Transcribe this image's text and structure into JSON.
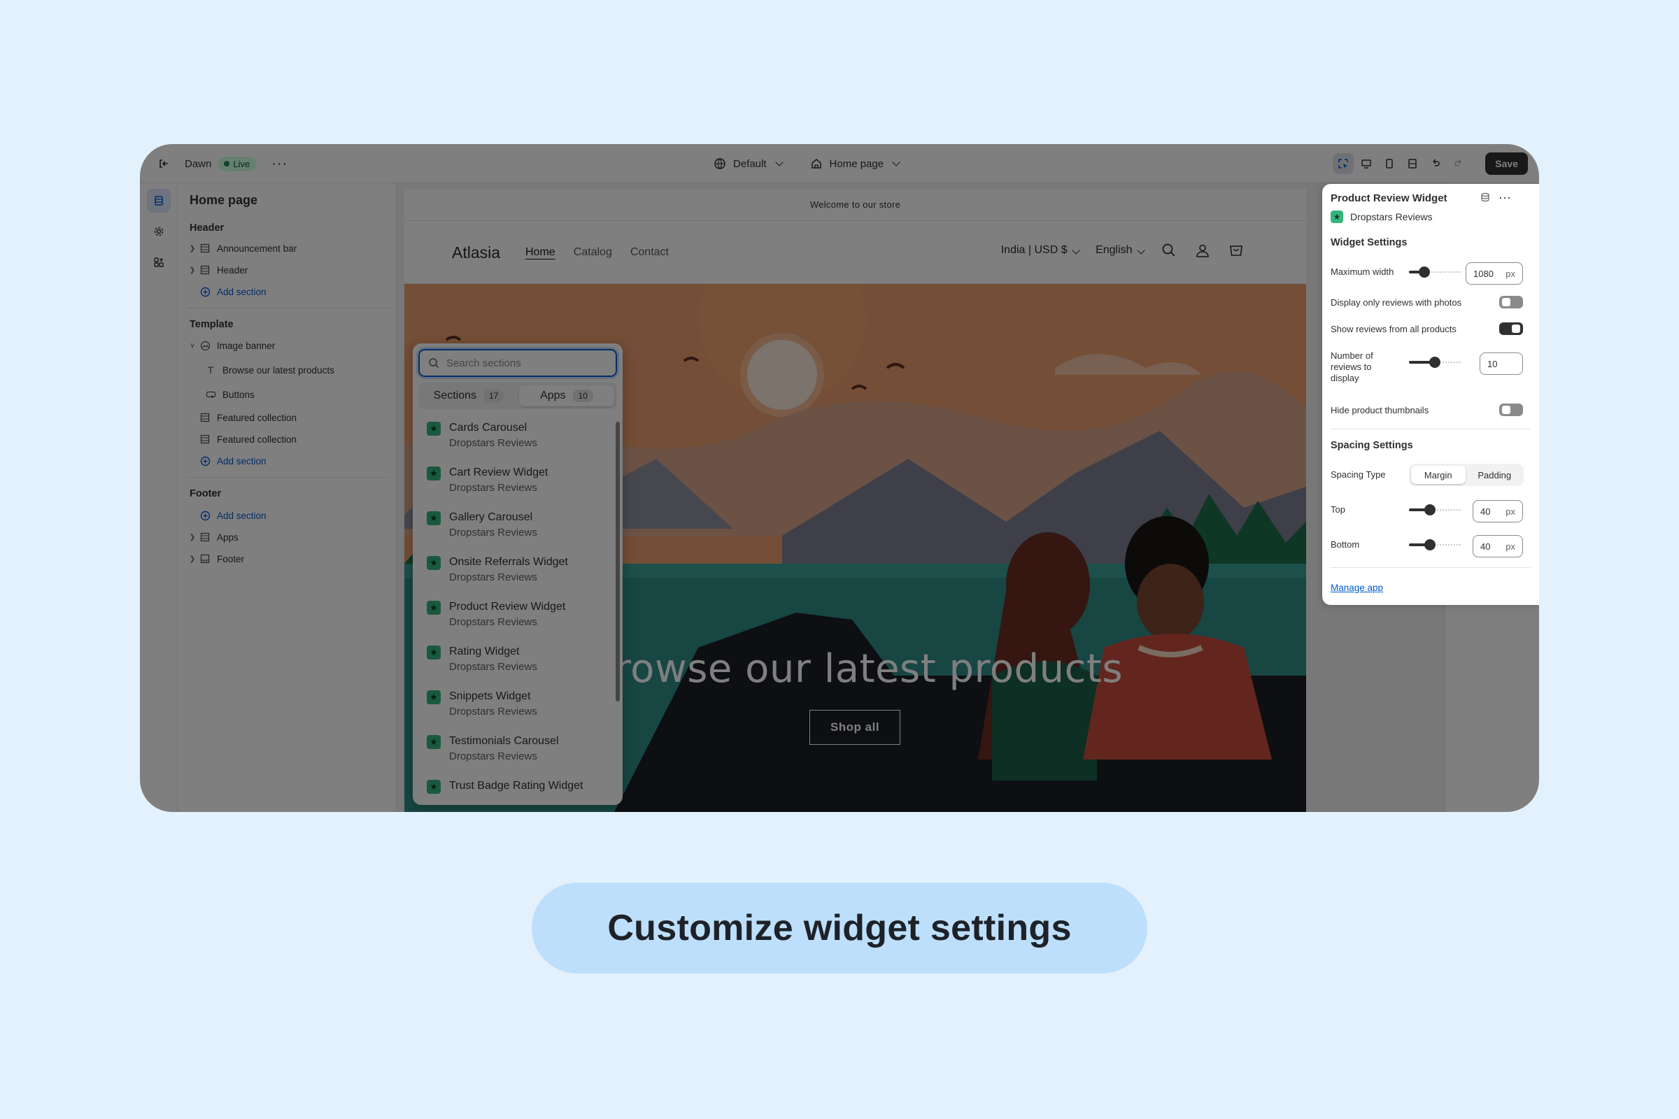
{
  "topbar": {
    "store_name": "Dawn",
    "live_label": "Live",
    "theme_picker": "Default",
    "page_picker": "Home page",
    "save_label": "Save"
  },
  "left_panel": {
    "title": "Home page",
    "header_group": "Header",
    "header_items": [
      "Announcement bar",
      "Header"
    ],
    "add_section": "Add section",
    "template_group": "Template",
    "template_items": {
      "image_banner": "Image banner",
      "banner_text": "Browse our latest products",
      "banner_buttons": "Buttons",
      "featured_1": "Featured collection",
      "featured_2": "Featured collection"
    },
    "footer_group": "Footer",
    "footer_items": [
      "Apps",
      "Footer"
    ]
  },
  "site": {
    "announcement": "Welcome to our store",
    "logo": "Atlasia",
    "nav": [
      "Home",
      "Catalog",
      "Contact"
    ],
    "currency": "India | USD $",
    "language": "English",
    "hero_title": "Browse our latest products",
    "hero_button": "Shop all"
  },
  "popover": {
    "search_placeholder": "Search sections",
    "tabs": [
      {
        "label": "Sections",
        "count": "17"
      },
      {
        "label": "Apps",
        "count": "10"
      }
    ],
    "items": [
      {
        "name": "Cards Carousel",
        "app": "Dropstars Reviews"
      },
      {
        "name": "Cart Review Widget",
        "app": "Dropstars Reviews"
      },
      {
        "name": "Gallery Carousel",
        "app": "Dropstars Reviews"
      },
      {
        "name": "Onsite Referrals Widget",
        "app": "Dropstars Reviews"
      },
      {
        "name": "Product Review Widget",
        "app": "Dropstars Reviews"
      },
      {
        "name": "Rating Widget",
        "app": "Dropstars Reviews"
      },
      {
        "name": "Snippets Widget",
        "app": "Dropstars Reviews"
      },
      {
        "name": "Testimonials Carousel",
        "app": "Dropstars Reviews"
      },
      {
        "name": "Trust Badge Rating Widget",
        "app": ""
      }
    ]
  },
  "settings": {
    "title": "Product Review Widget",
    "app_name": "Dropstars Reviews",
    "widget_section": "Widget Settings",
    "max_width_label": "Maximum width",
    "max_width_value": "1080",
    "max_width_unit": "px",
    "max_width_slider": 0.3,
    "photos_only_label": "Display only reviews with photos",
    "photos_only_on": false,
    "all_products_label": "Show reviews from all products",
    "all_products_on": true,
    "num_reviews_label": "Number of reviews to display",
    "num_reviews_value": "10",
    "num_reviews_slider": 0.5,
    "hide_thumbs_label": "Hide product thumbnails",
    "hide_thumbs_on": false,
    "spacing_section": "Spacing Settings",
    "spacing_type_label": "Spacing Type",
    "spacing_options": [
      "Margin",
      "Padding"
    ],
    "spacing_selected": "Margin",
    "top_label": "Top",
    "top_value": "40",
    "top_unit": "px",
    "top_slider": 0.4,
    "bottom_label": "Bottom",
    "bottom_value": "40",
    "bottom_unit": "px",
    "bottom_slider": 0.4,
    "manage_link": "Manage app"
  },
  "caption": "Customize widget settings"
}
